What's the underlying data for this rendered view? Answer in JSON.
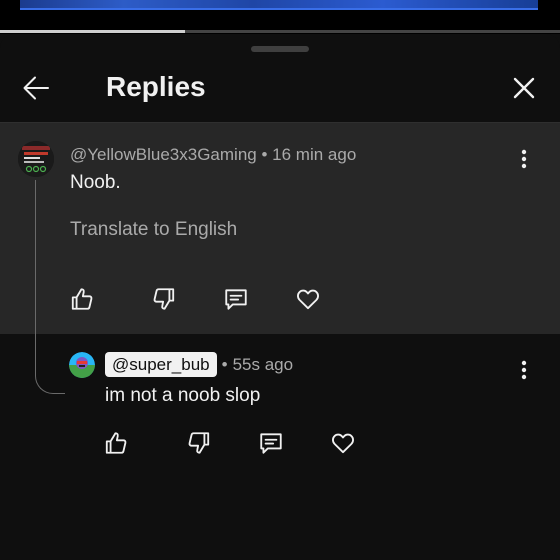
{
  "video": {
    "progress_fraction": 0.33
  },
  "header": {
    "title": "Replies"
  },
  "parent_comment": {
    "author": "@YellowBlue3x3Gaming",
    "separator": "•",
    "time": "16 min ago",
    "text": "Noob.",
    "translate_label": "Translate to English",
    "actions": [
      "thumbs-up-icon",
      "thumbs-down-icon",
      "reply-icon",
      "heart-icon"
    ]
  },
  "reply": {
    "mention": "@super_bub",
    "separator": "•",
    "time": "55s ago",
    "text": "im not a noob slop",
    "actions": [
      "thumbs-up-icon",
      "thumbs-down-icon",
      "reply-icon",
      "heart-icon"
    ]
  },
  "colors": {
    "background": "#0f0f0f",
    "highlight": "#272727",
    "text": "#f1f1f1",
    "secondary_text": "#aaaaaa"
  }
}
